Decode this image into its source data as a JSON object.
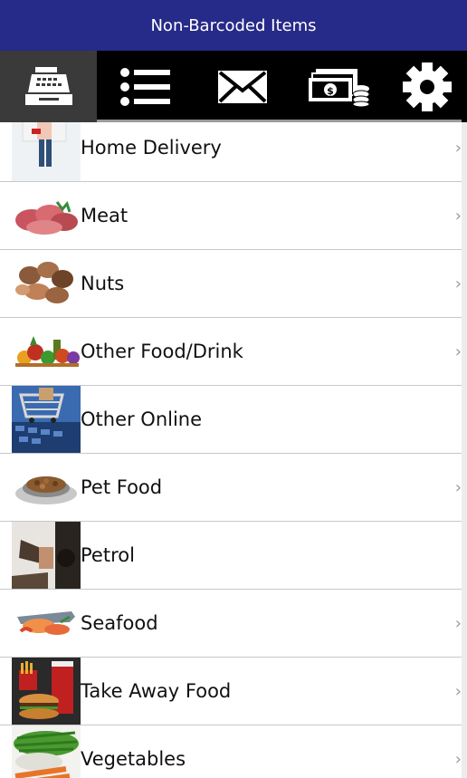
{
  "app": {
    "title": "Non-Barcoded Items"
  },
  "tabs": [
    {
      "icon": "cash-register-icon",
      "active": true
    },
    {
      "icon": "list-icon",
      "active": false
    },
    {
      "icon": "envelope-icon",
      "active": false
    },
    {
      "icon": "money-icon",
      "active": false
    },
    {
      "icon": "gear-icon",
      "active": false
    }
  ],
  "items": [
    {
      "label": "Home Delivery",
      "chevron": true
    },
    {
      "label": "Meat",
      "chevron": true
    },
    {
      "label": "Nuts",
      "chevron": true
    },
    {
      "label": "Other Food/Drink",
      "chevron": true
    },
    {
      "label": "Other Online",
      "chevron": false
    },
    {
      "label": "Pet Food",
      "chevron": true
    },
    {
      "label": "Petrol",
      "chevron": false
    },
    {
      "label": "Seafood",
      "chevron": true
    },
    {
      "label": "Take Away Food",
      "chevron": true
    },
    {
      "label": "Vegetables",
      "chevron": true
    }
  ],
  "colors": {
    "titlebar": "#262a88",
    "tabbar": "#000000",
    "active_tab": "#3a3a3a"
  }
}
